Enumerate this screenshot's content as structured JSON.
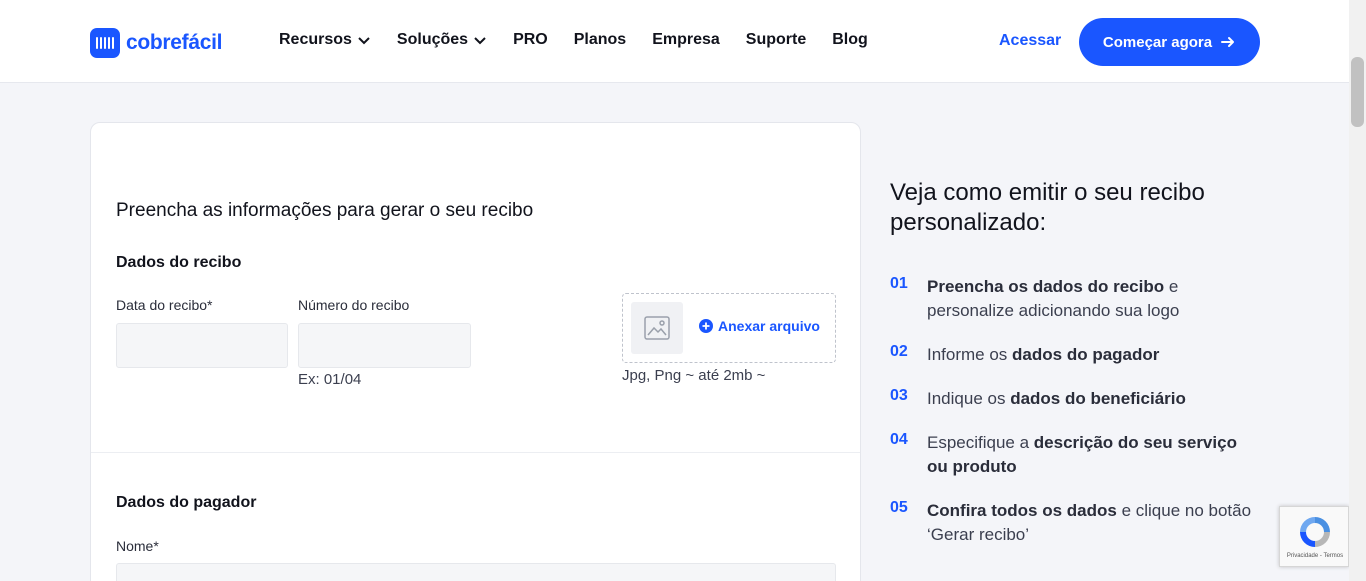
{
  "header": {
    "logo_text": "cobrefácil",
    "nav": [
      {
        "label": "Recursos",
        "dropdown": true
      },
      {
        "label": "Soluções",
        "dropdown": true
      },
      {
        "label": "PRO",
        "dropdown": false
      },
      {
        "label": "Planos",
        "dropdown": false
      },
      {
        "label": "Empresa",
        "dropdown": false
      },
      {
        "label": "Suporte",
        "dropdown": false
      },
      {
        "label": "Blog",
        "dropdown": false
      }
    ],
    "login_label": "Acessar",
    "cta_label": "Começar agora"
  },
  "form": {
    "title": "Preencha as informações para gerar o seu recibo",
    "receipt_section": "Dados do recibo",
    "date_label": "Data do recibo*",
    "date_value": "",
    "number_label": "Número do recibo",
    "number_value": "",
    "number_hint": "Ex: 01/04",
    "upload_label": "Anexar arquivo",
    "upload_hint": "Jpg, Png ~ até 2mb ~",
    "payer_section": "Dados do pagador",
    "name_label": "Nome*",
    "name_value": ""
  },
  "steps": {
    "title": "Veja como emitir o seu recibo personalizado:",
    "items": [
      {
        "num": "01",
        "bold": "Preencha os dados do recibo",
        "rest": " e personalize adicionando sua logo"
      },
      {
        "num": "02",
        "pre": "Informe os ",
        "bold": "dados do pagador"
      },
      {
        "num": "03",
        "pre": "Indique os ",
        "bold": "dados do beneficiário"
      },
      {
        "num": "04",
        "pre": "Especifique a ",
        "bold": "descrição do seu serviço ou produto"
      },
      {
        "num": "05",
        "bold": "Confira todos os dados",
        "rest": " e clique no botão ‘Gerar recibo’"
      }
    ]
  },
  "recaptcha": {
    "text": "Privacidade - Termos"
  },
  "colors": {
    "accent": "#1a56ff",
    "background": "#f4f5f9"
  }
}
